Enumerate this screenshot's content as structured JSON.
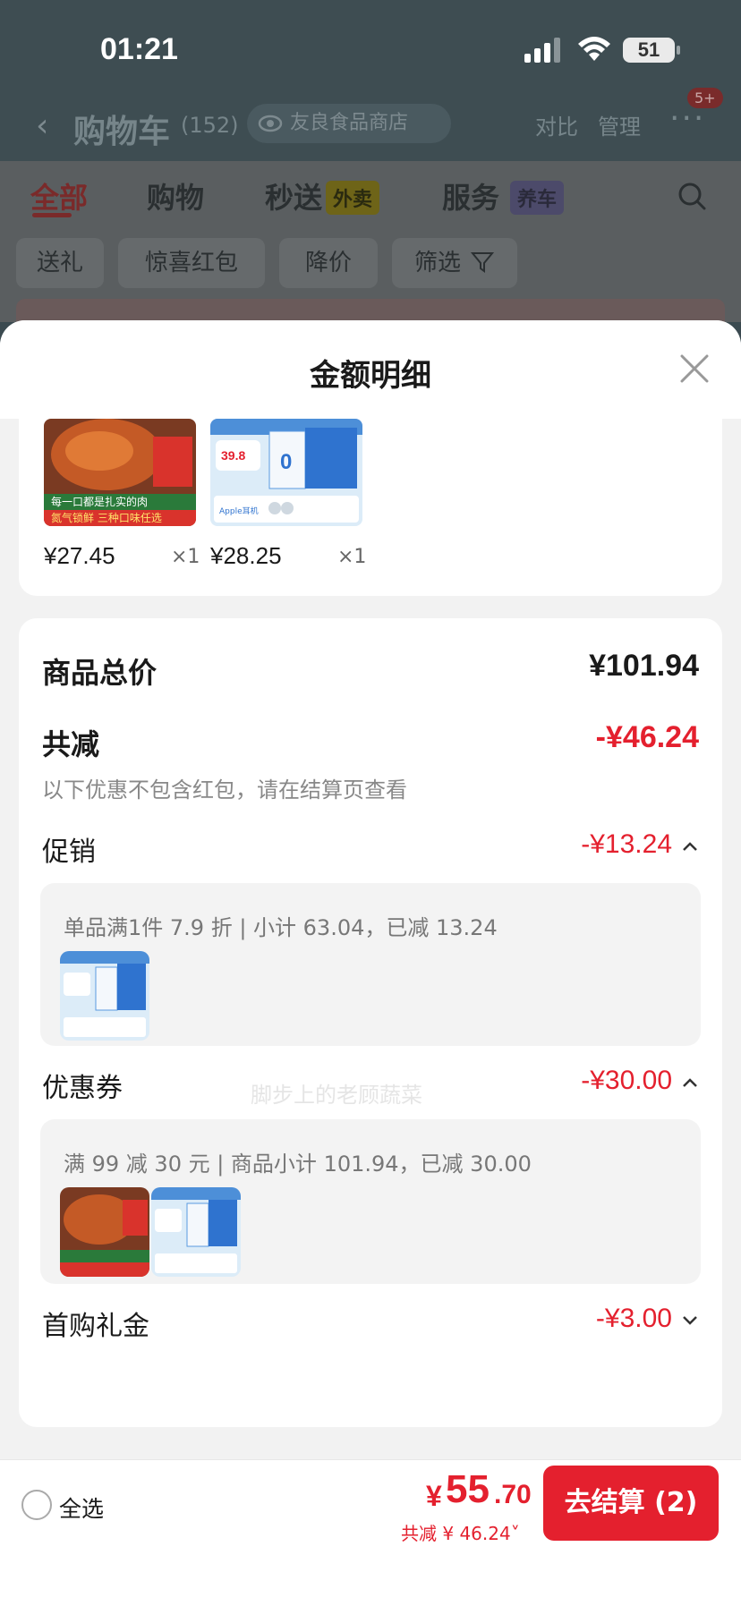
{
  "status_bar": {
    "time": "01:21",
    "battery": "51"
  },
  "cart_header": {
    "title": "购物车",
    "count": "(152)",
    "store": "友良食品商店",
    "compare": "对比",
    "manage": "管理",
    "more_badge": "5+"
  },
  "tabs": [
    {
      "label": "全部"
    },
    {
      "label": "购物"
    },
    {
      "label": "秒送"
    },
    {
      "label": "服务"
    }
  ],
  "tab_tags": {
    "miaosong": "外卖",
    "fuwu": "养车"
  },
  "filter_chips": [
    "送礼",
    "惊喜红包",
    "降价",
    "筛选"
  ],
  "sheet": {
    "title": "金额明细",
    "products": [
      {
        "price": "¥27.45",
        "qty": "×1",
        "img_text": "每一口都是扎实的肉",
        "img_text2": "氮气锁鲜 三种口味任选"
      },
      {
        "price": "¥28.25",
        "qty": "×1",
        "img_text": "39.8",
        "img_text2": "Apple耳机"
      }
    ],
    "summary": {
      "total_label": "商品总价",
      "total_value": "¥101.94",
      "discount_label": "共减",
      "discount_value": "-¥46.24",
      "note": "以下优惠不包含红包，请在结算页查看",
      "promo_label": "促销",
      "promo_value": "-¥13.24",
      "promo_detail": "单品满1件 7.9 折 | 小计 63.04，已减 13.24",
      "coupon_label": "优惠券",
      "coupon_value": "-¥30.00",
      "coupon_detail": "满 99 减 30 元 | 商品小计 101.94，已减 30.00",
      "gift_label": "首购礼金",
      "gift_value": "-¥3.00"
    },
    "watermark": "脚步上的老顾蔬菜"
  },
  "bottom_bar": {
    "select_all": "全选",
    "total_yen": "¥",
    "total_int": "55",
    "total_dec": ".70",
    "total_saved": "共减 ¥ 46.24",
    "checkout_label": "去结算 (2)"
  },
  "colors": {
    "accent_red": "#e4202e",
    "overlay": "#3e4d52",
    "sheet_bg": "#f2f2f2"
  }
}
